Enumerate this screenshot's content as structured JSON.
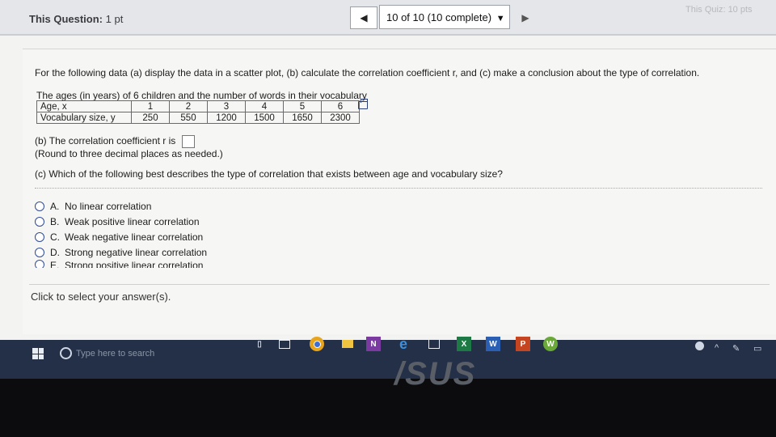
{
  "header": {
    "question_label": "This Question:",
    "points": "1 pt",
    "prev_arrow": "◀",
    "status": "10 of 10 (10 complete)",
    "dropdown_caret": "▼",
    "next_arrow": "▶",
    "quiz_info": "This Quiz: 10 pts"
  },
  "question": {
    "instruction": "For the following data (a) display the data in a scatter plot, (b) calculate the correlation coefficient r, and (c) make a conclusion about the type of correlation.",
    "table_caption": "The ages (in years) of 6 children and the number of words in their vocabulary",
    "table": {
      "row_labels": [
        "Age, x",
        "Vocabulary size, y"
      ],
      "ages": [
        "1",
        "2",
        "3",
        "4",
        "5",
        "6"
      ],
      "vocab": [
        "250",
        "550",
        "1200",
        "1500",
        "1650",
        "2300"
      ]
    },
    "part_b_label": "(b) The correlation coefficient r is",
    "part_b_value": "",
    "part_b_note": "(Round to three decimal places as needed.)",
    "part_c_label": "(c) Which of the following best describes the type of correlation that exists between age and vocabulary size?",
    "options": [
      {
        "letter": "A.",
        "text": "No linear correlation"
      },
      {
        "letter": "B.",
        "text": "Weak positive linear correlation"
      },
      {
        "letter": "C.",
        "text": "Weak negative linear correlation"
      },
      {
        "letter": "D.",
        "text": "Strong negative linear correlation"
      },
      {
        "letter": "E.",
        "text": "Strong positive linear correlation"
      }
    ]
  },
  "footer": {
    "hint": "Click to select your answer(s)."
  },
  "taskbar": {
    "search_placeholder": "Type here to search",
    "icons": [
      "mic-icon",
      "task-view-icon",
      "chrome-icon",
      "file-explorer-icon",
      "onenote-icon",
      "edge-icon",
      "store-icon",
      "excel-icon",
      "word-icon",
      "powerpoint-icon",
      "app-w-icon"
    ],
    "icon_letters": {
      "onenote": "N",
      "excel": "X",
      "word": "W",
      "powerpoint": "P",
      "app_w": "W"
    }
  },
  "bezel": {
    "brand": "/SUS"
  },
  "colors": {
    "radio_accent": "#2f4b9a",
    "taskbar": "#243047"
  }
}
